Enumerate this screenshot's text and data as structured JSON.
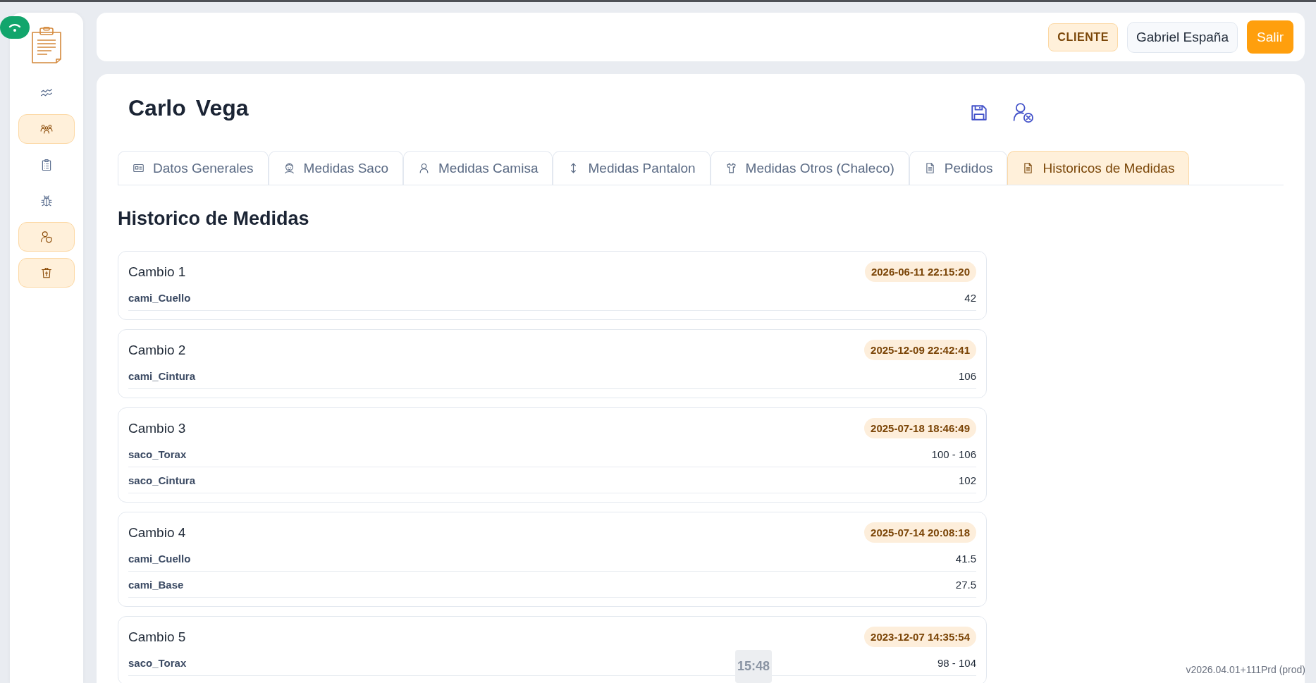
{
  "sidebar": {
    "items": [
      {
        "selected": false
      },
      {
        "selected": true
      },
      {
        "selected": false
      },
      {
        "selected": false
      },
      {
        "selected": true
      },
      {
        "selected": true
      }
    ]
  },
  "topbar": {
    "role_badge": "CLIENTE",
    "user_name": "Gabriel España",
    "logout_button": "Salir"
  },
  "client": {
    "first_name": "Carlo",
    "last_name": "Vega"
  },
  "tabs": [
    {
      "label": "Datos Generales",
      "selected": false
    },
    {
      "label": "Medidas Saco",
      "selected": false
    },
    {
      "label": "Medidas Camisa",
      "selected": false
    },
    {
      "label": "Medidas Pantalon",
      "selected": false
    },
    {
      "label": "Medidas Otros (Chaleco)",
      "selected": false
    },
    {
      "label": "Pedidos",
      "selected": false
    },
    {
      "label": "Historicos de Medidas",
      "selected": true
    }
  ],
  "section_title": "Historico de Medidas",
  "changes": [
    {
      "title": "Cambio 1",
      "date": "2026-06-11 22:15:20",
      "rows": [
        {
          "field": "cami_Cuello",
          "value": "42"
        }
      ]
    },
    {
      "title": "Cambio 2",
      "date": "2025-12-09 22:42:41",
      "rows": [
        {
          "field": "cami_Cintura",
          "value": "106"
        }
      ]
    },
    {
      "title": "Cambio 3",
      "date": "2025-07-18 18:46:49",
      "rows": [
        {
          "field": "saco_Torax",
          "value": "100 - 106"
        },
        {
          "field": "saco_Cintura",
          "value": "102"
        }
      ]
    },
    {
      "title": "Cambio 4",
      "date": "2025-07-14 20:08:18",
      "rows": [
        {
          "field": "cami_Cuello",
          "value": "41.5"
        },
        {
          "field": "cami_Base",
          "value": "27.5"
        }
      ]
    },
    {
      "title": "Cambio 5",
      "date": "2023-12-07 14:35:54",
      "rows": [
        {
          "field": "saco_Torax",
          "value": "98 - 104"
        }
      ]
    }
  ],
  "clock_overlay": "15:48",
  "version": "v2026.04.01+111Prd (prod)"
}
